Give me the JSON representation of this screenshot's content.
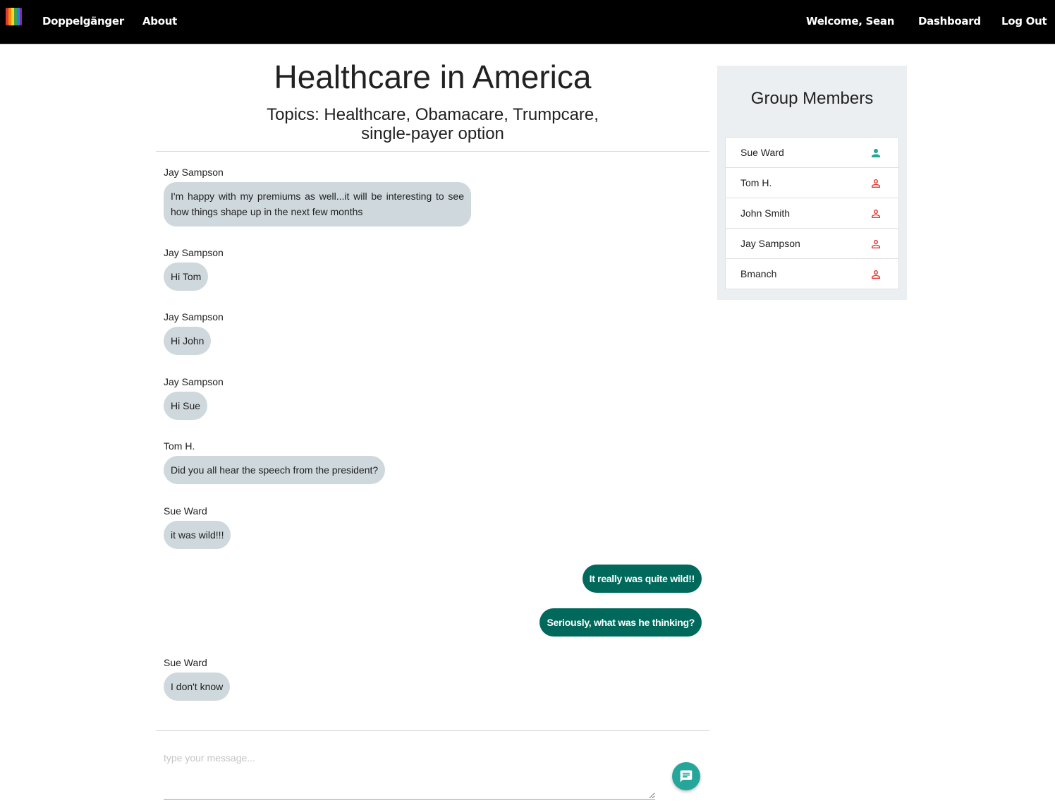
{
  "nav": {
    "brand": "Doppelgänger",
    "about": "About",
    "welcome": "Welcome, Sean",
    "dashboard": "Dashboard",
    "logout": "Log Out",
    "logo_icon": "rainbow-logo-icon"
  },
  "chat": {
    "title": "Healthcare in America",
    "topics": "Topics: Healthcare, Obamacare, Trumpcare, single-payer option",
    "messages": [
      {
        "author": "Jay Sampson",
        "text": "I'm happy with my premiums as well...it will be interesting to see how things shape up in the next few months"
      },
      {
        "author": "Jay Sampson",
        "text": "Hi Tom"
      },
      {
        "author": "Jay Sampson",
        "text": "Hi John"
      },
      {
        "author": "Jay Sampson",
        "text": "Hi Sue"
      },
      {
        "author": "Tom H.",
        "text": "Did you all hear the speech from the president?"
      },
      {
        "author": "Sue Ward",
        "text": "it was wild!!!"
      },
      {
        "author": "",
        "text": "It really was quite wild!!"
      },
      {
        "author": "",
        "text": "Seriously, what was he thinking?"
      },
      {
        "author": "Sue Ward",
        "text": "I don't know"
      }
    ],
    "input_placeholder": "type your message...",
    "send_icon": "chat-bubble-icon"
  },
  "group": {
    "title": "Group Members",
    "members": [
      {
        "name": "Sue Ward",
        "status": "online"
      },
      {
        "name": "Tom H.",
        "status": "offline"
      },
      {
        "name": "John Smith",
        "status": "offline"
      },
      {
        "name": "Jay Sampson",
        "status": "offline"
      },
      {
        "name": "Bmanch",
        "status": "offline"
      }
    ]
  },
  "colors": {
    "navbar": "#000000",
    "incoming_bubble": "#cfd8dc",
    "outgoing_bubble": "#00695c",
    "send_button": "#26a69a",
    "online_icon": "#26a69a",
    "offline_icon": "#e53935",
    "panel_bg": "#eceff1"
  }
}
